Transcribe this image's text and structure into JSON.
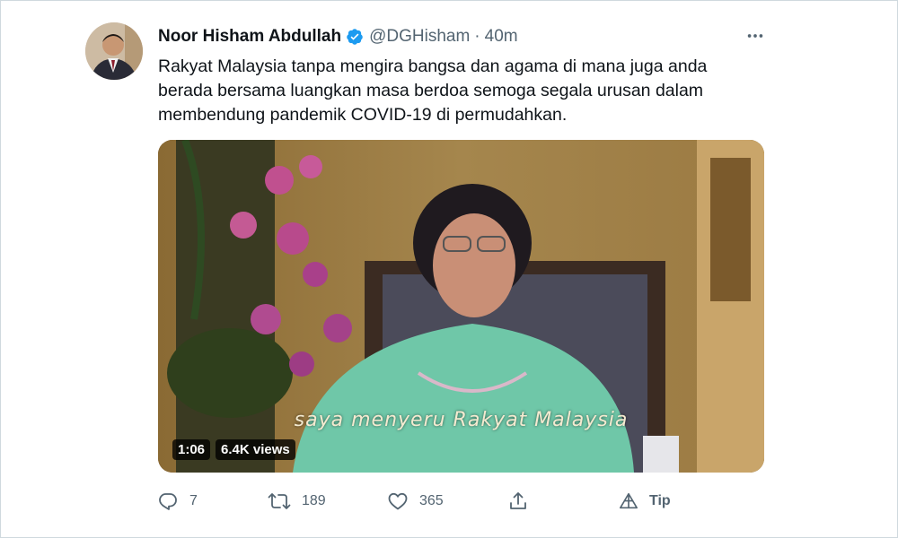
{
  "tweet": {
    "author": {
      "display_name": "Noor Hisham Abdullah",
      "handle": "@DGHisham",
      "verified_icon": "verified-badge-icon",
      "verified_color": "#1d9bf0"
    },
    "separator": "·",
    "time": "40m",
    "more_icon": "more-horizontal-icon",
    "text_lines": [
      "Rakyat Malaysia tanpa mengira bangsa dan agama di mana juga anda",
      "berada bersama luangkan masa berdoa semoga segala urusan dalam",
      "membendung pandemik COVID-19 di permudahkan."
    ],
    "video": {
      "caption": "saya menyeru Rakyat Malaysia",
      "duration": "1:06",
      "views": "6.4K views"
    },
    "actions": {
      "reply": {
        "icon": "reply-icon",
        "count": "7"
      },
      "retweet": {
        "icon": "retweet-icon",
        "count": "189"
      },
      "like": {
        "icon": "like-icon",
        "count": "365"
      },
      "share": {
        "icon": "share-icon"
      },
      "tip": {
        "icon": "tip-icon",
        "label": "Tip"
      }
    }
  },
  "colors": {
    "text_primary": "#0f1419",
    "text_secondary": "#536471",
    "border": "#cfd9de",
    "accent": "#1d9bf0"
  }
}
